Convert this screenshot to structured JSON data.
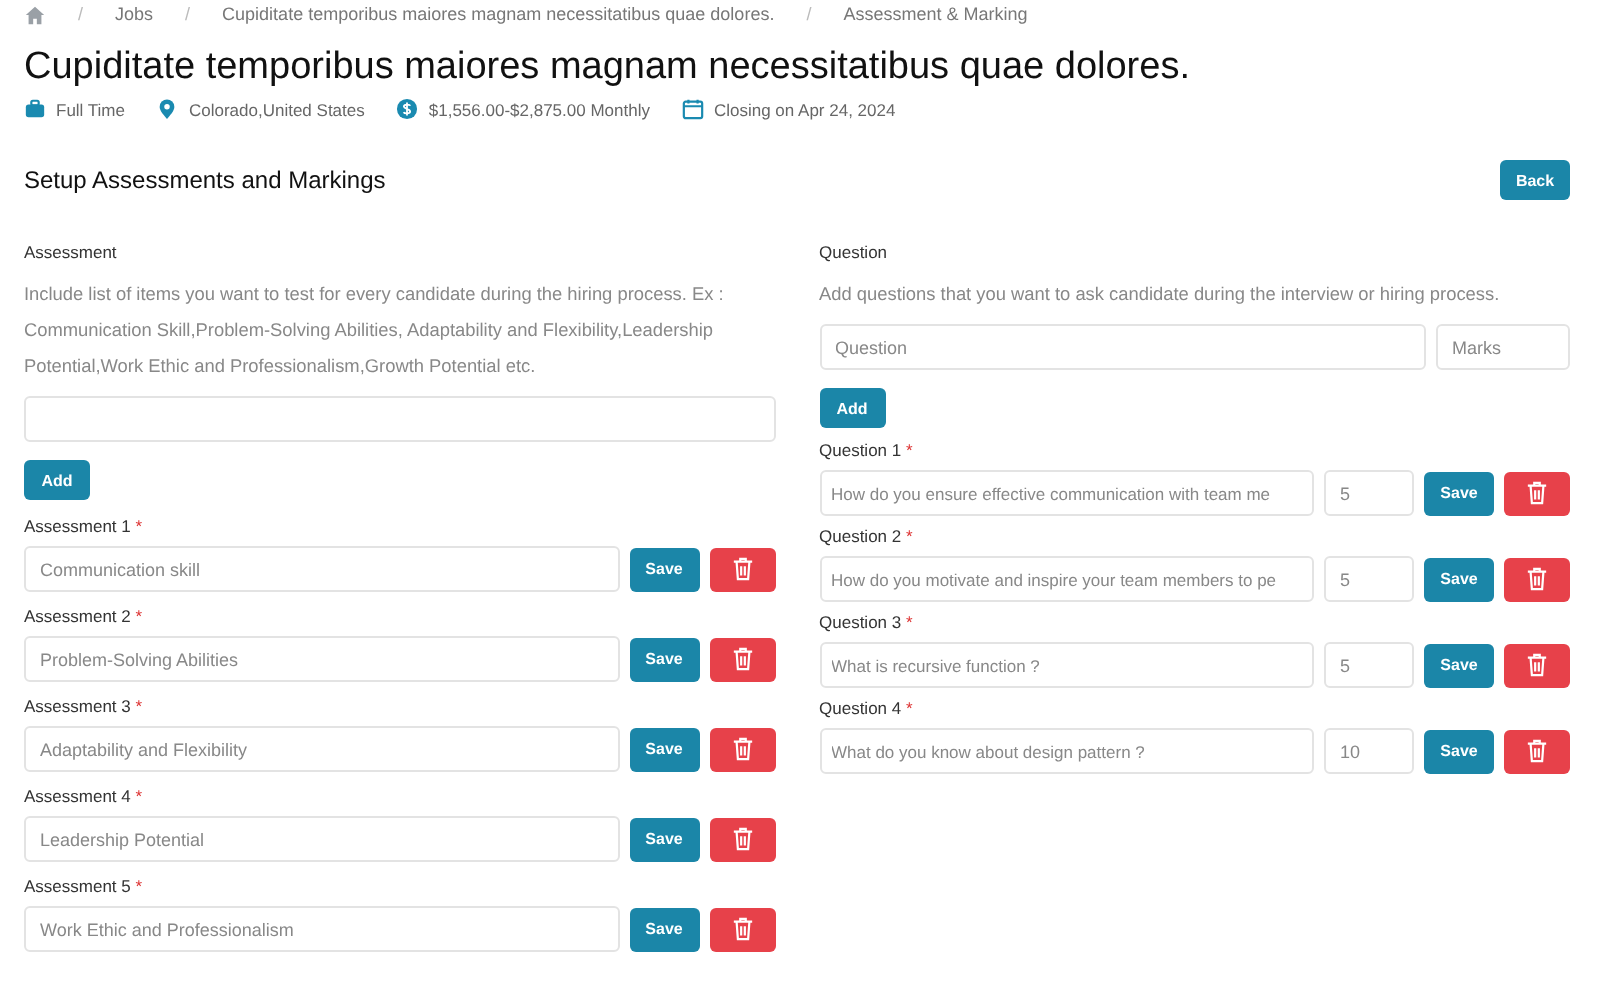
{
  "breadcrumb": {
    "separator": "/",
    "items": [
      "Jobs",
      "Cupiditate temporibus maiores magnam necessitatibus quae dolores.",
      "Assessment & Marking"
    ]
  },
  "job": {
    "title": "Cupiditate temporibus maiores magnam necessitatibus quae dolores.",
    "meta": [
      {
        "kind": "type",
        "text": "Full Time"
      },
      {
        "kind": "location",
        "text": "Colorado,United States"
      },
      {
        "kind": "salary",
        "text": "$1,556.00-$2,875.00 Monthly"
      },
      {
        "kind": "date",
        "text": "Closing on Apr 24, 2024"
      }
    ]
  },
  "section": {
    "title": "Setup Assessments and Markings",
    "back_button": "Back"
  },
  "assessment": {
    "label": "Assessment",
    "description": "Include list of items you want to test for every candidate during the hiring process. Ex : Communication Skill,Problem-Solving Abilities, Adaptability and Flexibility,Leadership Potential,Work Ethic and Professionalism,Growth Potential etc.",
    "add_button": "Add",
    "items": [
      {
        "label": "Assessment 1",
        "required": "*",
        "value": "Communication skill",
        "save": "Save"
      },
      {
        "label": "Assessment 2",
        "required": "*",
        "value": "Problem-Solving Abilities",
        "save": "Save"
      },
      {
        "label": "Assessment 3",
        "required": "*",
        "value": "Adaptability and Flexibility",
        "save": "Save"
      },
      {
        "label": "Assessment 4",
        "required": "*",
        "value": "Leadership Potential",
        "save": "Save"
      },
      {
        "label": "Assessment 5",
        "required": "*",
        "value": "Work Ethic and Professionalism",
        "save": "Save"
      }
    ]
  },
  "question": {
    "label": "Question",
    "description": "Add questions that you want to ask candidate during the interview or hiring process.",
    "question_placeholder": "Question",
    "marks_placeholder": "Marks",
    "add_button": "Add",
    "items": [
      {
        "label": "Question 1",
        "required": "*",
        "value": "How do you ensure effective communication with team me",
        "marks": "5",
        "save": "Save"
      },
      {
        "label": "Question 2",
        "required": "*",
        "value": "How do you motivate and inspire your team members to pe",
        "marks": "5",
        "save": "Save"
      },
      {
        "label": "Question 3",
        "required": "*",
        "value": "What is recursive function ?",
        "marks": "5",
        "save": "Save"
      },
      {
        "label": "Question 4",
        "required": "*",
        "value": "What do you know about design pattern ?",
        "marks": "10",
        "save": "Save"
      }
    ]
  }
}
